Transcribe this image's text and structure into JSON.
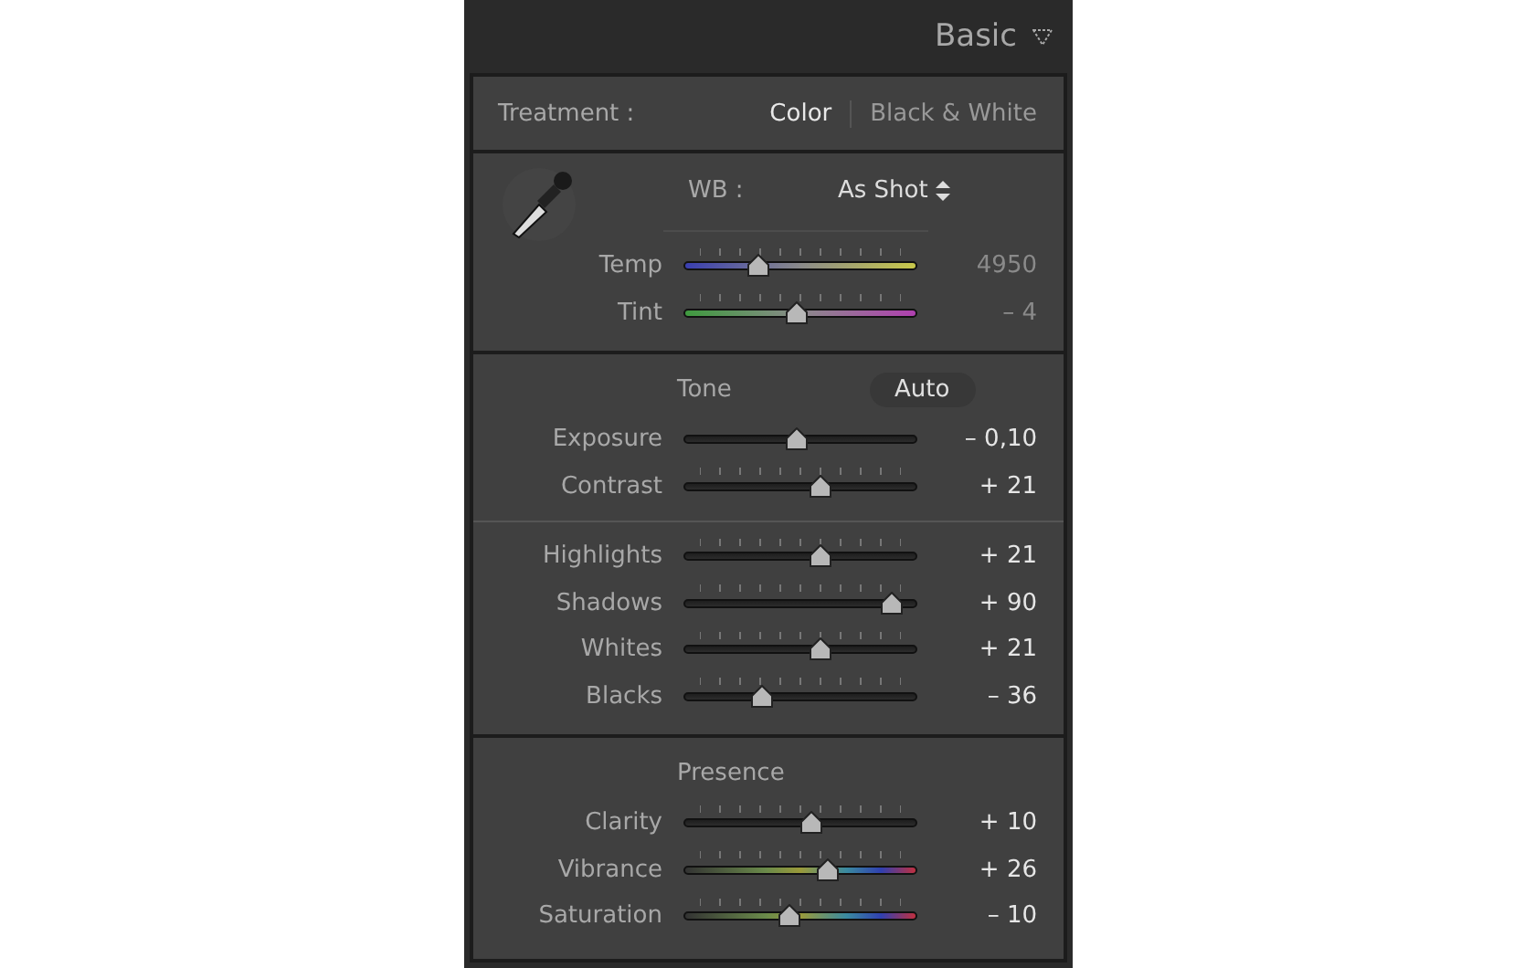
{
  "header": {
    "title": "Basic"
  },
  "treatment": {
    "label": "Treatment :",
    "options": [
      {
        "label": "Color",
        "selected": true
      },
      {
        "label": "Black & White",
        "selected": false
      }
    ]
  },
  "white_balance": {
    "label": "WB :",
    "value": "As Shot",
    "sliders": [
      {
        "name": "Temp",
        "kind": "temp",
        "ticks": true,
        "level": 0.32,
        "reading": "4950"
      },
      {
        "name": "Tint",
        "kind": "tint",
        "ticks": true,
        "level": 0.49,
        "reading": "– 4"
      }
    ]
  },
  "tone": {
    "title": "Tone",
    "auto_button": "Auto",
    "sliders": [
      {
        "name": "Exposure",
        "kind": "plain",
        "ticks": false,
        "level": 0.49,
        "reading": "– 0,10"
      },
      {
        "name": "Contrast",
        "kind": "plain",
        "ticks": true,
        "level": 0.59,
        "reading": "+ 21"
      }
    ]
  },
  "tone_regions": {
    "sliders": [
      {
        "name": "Highlights",
        "kind": "plain",
        "ticks": true,
        "level": 0.59,
        "reading": "+ 21"
      },
      {
        "name": "Shadows",
        "kind": "plain",
        "ticks": true,
        "level": 0.9,
        "reading": "+ 90"
      },
      {
        "name": "Whites",
        "kind": "plain",
        "ticks": true,
        "level": 0.59,
        "reading": "+ 21"
      },
      {
        "name": "Blacks",
        "kind": "plain",
        "ticks": true,
        "level": 0.34,
        "reading": "– 36"
      }
    ]
  },
  "presence": {
    "title": "Presence",
    "sliders": [
      {
        "name": "Clarity",
        "kind": "plain",
        "ticks": true,
        "level": 0.55,
        "reading": "+ 10"
      },
      {
        "name": "Vibrance",
        "kind": "color",
        "ticks": true,
        "level": 0.62,
        "reading": "+ 26"
      },
      {
        "name": "Saturation",
        "kind": "color",
        "ticks": true,
        "level": 0.46,
        "reading": "– 10"
      }
    ]
  }
}
